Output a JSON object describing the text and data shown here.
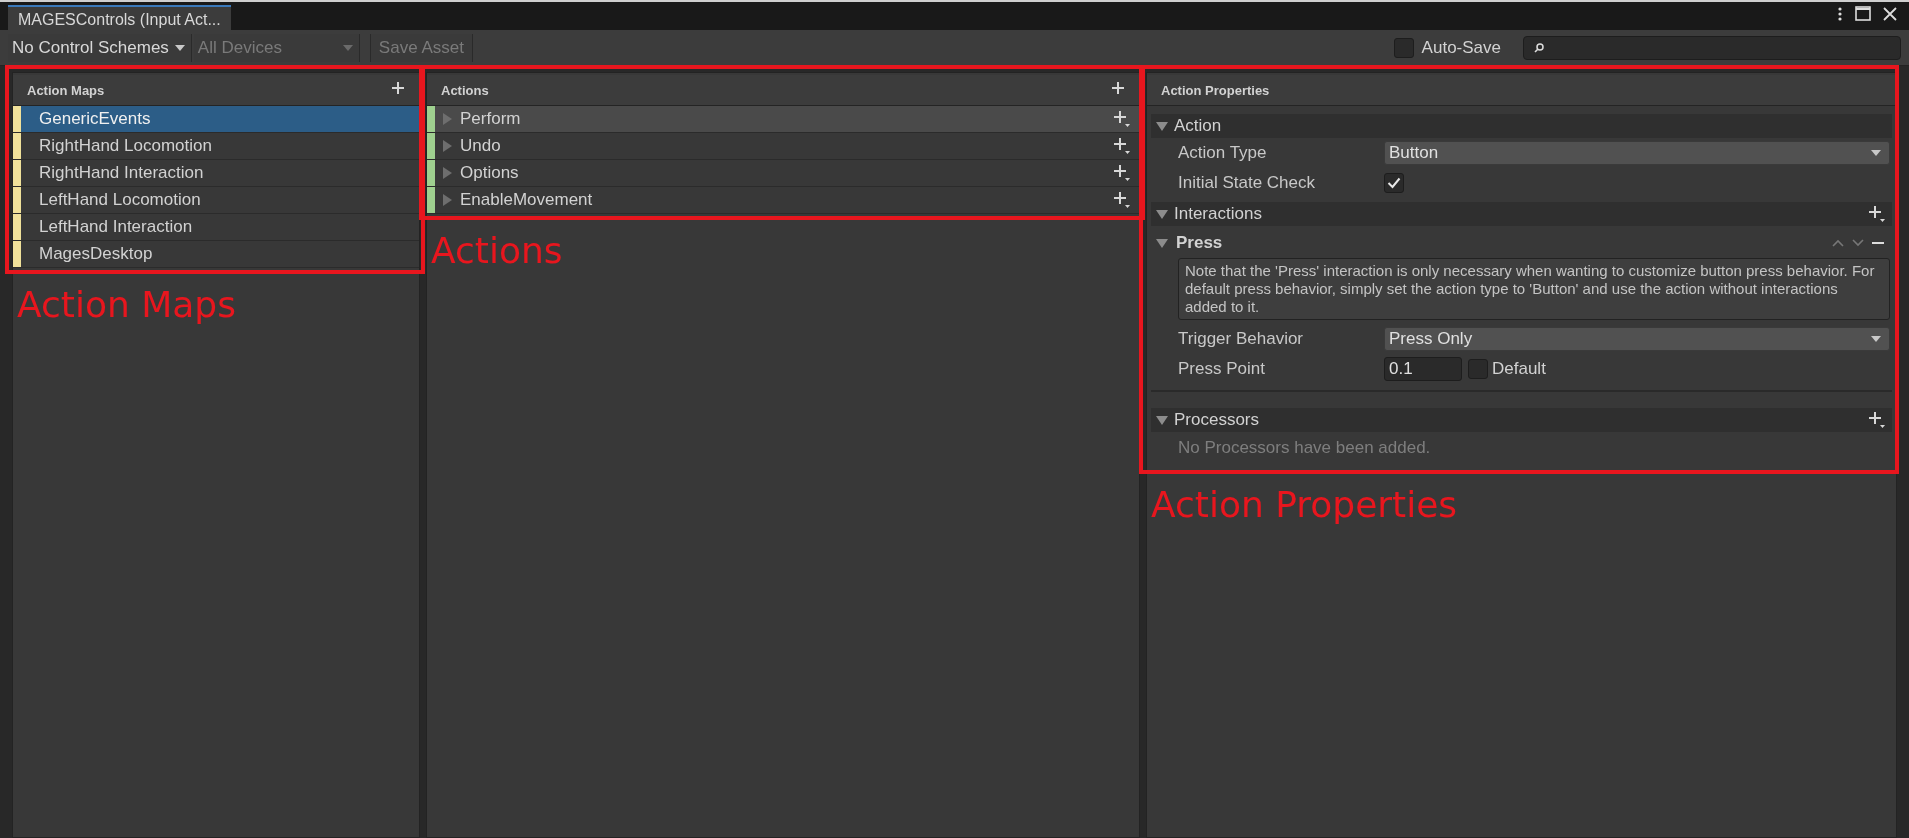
{
  "window": {
    "tab": {
      "label": "MAGESControls (Input Act...",
      "selected": true
    }
  },
  "toolbar": {
    "control_scheme": {
      "label": "No Control Schemes",
      "disabled": false
    },
    "devices": {
      "label": "All Devices",
      "disabled": true
    },
    "save_button": {
      "label": "Save Asset",
      "disabled": true
    },
    "auto_save": {
      "label": "Auto-Save",
      "checked": false
    }
  },
  "action_maps": {
    "title": "Action Maps",
    "items": [
      {
        "label": "GenericEvents",
        "selected": true
      },
      {
        "label": "RightHand Locomotion",
        "selected": false
      },
      {
        "label": "RightHand Interaction",
        "selected": false
      },
      {
        "label": "LeftHand Locomotion",
        "selected": false
      },
      {
        "label": "LeftHand Interaction",
        "selected": false
      },
      {
        "label": "MagesDesktop",
        "selected": false
      }
    ]
  },
  "actions": {
    "title": "Actions",
    "items": [
      {
        "label": "Perform",
        "selected": true,
        "expanded": false
      },
      {
        "label": "Undo",
        "selected": false,
        "expanded": false
      },
      {
        "label": "Options",
        "selected": false,
        "expanded": false
      },
      {
        "label": "EnableMovement",
        "selected": false,
        "expanded": false
      }
    ]
  },
  "properties": {
    "title": "Action Properties",
    "action": {
      "title": "Action",
      "expanded": true,
      "fields": [
        {
          "kind": "dropdown",
          "label": "Action Type",
          "value": "Button"
        },
        {
          "kind": "checkbox",
          "label": "Initial State Check",
          "checked": true
        }
      ]
    },
    "interactions": {
      "title": "Interactions",
      "expanded": true,
      "items": [
        {
          "title": "Press",
          "expanded": true,
          "help": "Note that the 'Press' interaction is only necessary when wanting to customize button press behavior. For default press behavior, simply set the action type to 'Button' and use the action without interactions added to it.",
          "fields": [
            {
              "kind": "dropdown",
              "label": "Trigger Behavior",
              "value": "Press Only"
            },
            {
              "kind": "number",
              "label": "Press Point",
              "value": "0.1",
              "default": {
                "label": "Default",
                "checked": false
              }
            }
          ]
        }
      ]
    },
    "processors": {
      "title": "Processors",
      "expanded": true,
      "empty_text": "No Processors have been added."
    }
  },
  "annotations": [
    {
      "label": "Action Maps"
    },
    {
      "label": "Actions"
    },
    {
      "label": "Action Properties"
    }
  ]
}
